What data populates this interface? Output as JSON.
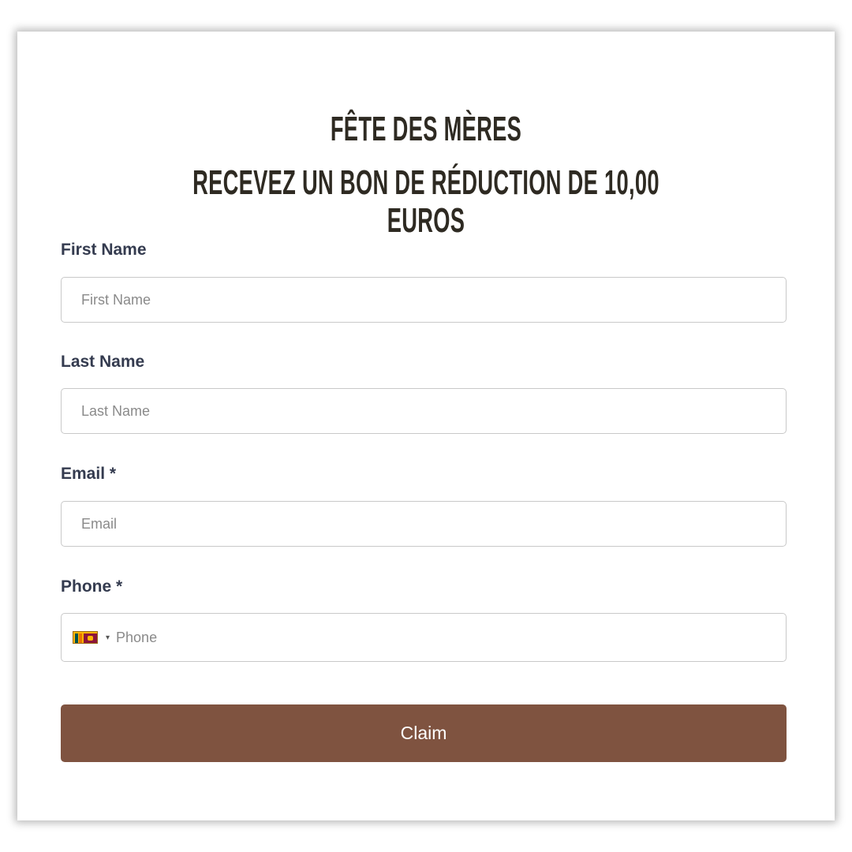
{
  "form": {
    "title_line1": "FÊTE DES MÈRES",
    "title_line2": "RECEVEZ UN BON DE RÉDUCTION DE 10,00 EUROS",
    "first_name": {
      "label": "First Name",
      "placeholder": "First Name",
      "value": ""
    },
    "last_name": {
      "label": "Last Name",
      "placeholder": "Last Name",
      "value": ""
    },
    "email": {
      "label": "Email *",
      "placeholder": "Email",
      "value": ""
    },
    "phone": {
      "label": "Phone *",
      "placeholder": "Phone",
      "value": "",
      "country_flag": "sri-lanka-flag-icon",
      "caret": "▾"
    },
    "submit_label": "Claim"
  },
  "colors": {
    "button_bg": "#7f5340",
    "heading": "#2e2a22",
    "label": "#343b4f",
    "border": "#c9c9c9"
  }
}
